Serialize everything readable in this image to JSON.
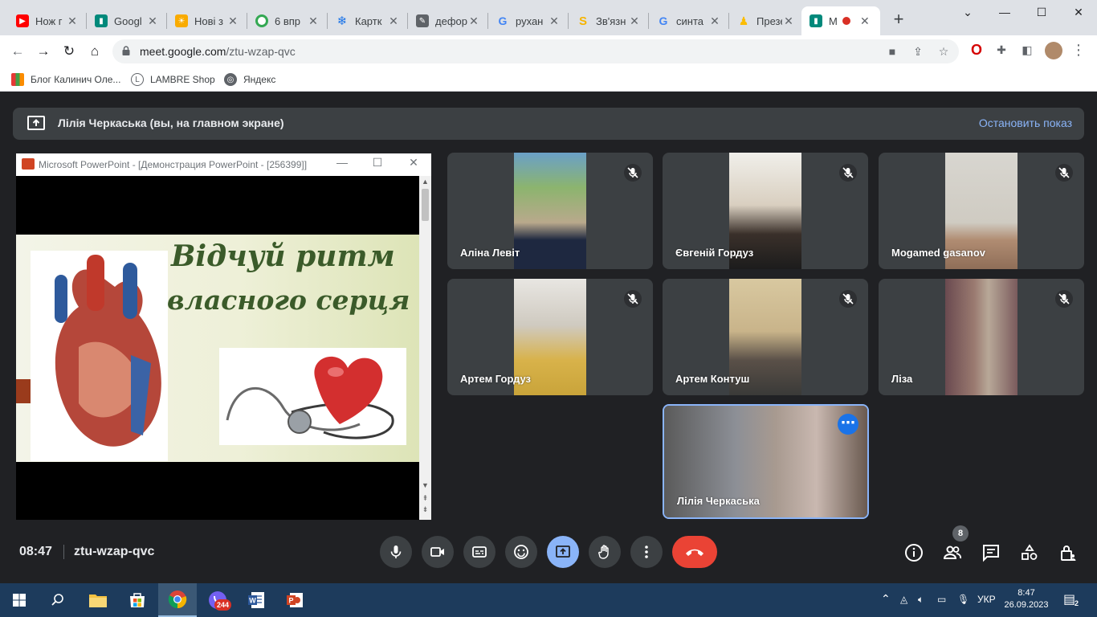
{
  "browser": {
    "tabs": [
      {
        "title": "Нож г",
        "icon": "youtube-icon",
        "color": "#ff0000"
      },
      {
        "title": "Googl",
        "icon": "meet-icon",
        "color": "#00897b"
      },
      {
        "title": "Нові з",
        "icon": "sun-icon",
        "color": "#f9ab00"
      },
      {
        "title": "6 впр",
        "icon": "circle-icon",
        "color": "#34a853"
      },
      {
        "title": "Картк",
        "icon": "snowflake-icon",
        "color": "#1a73e8"
      },
      {
        "title": "дефор",
        "icon": "pen-icon",
        "color": "#5f6368"
      },
      {
        "title": "рухан",
        "icon": "google-icon",
        "color": "#4285f4"
      },
      {
        "title": "Зв'язн",
        "icon": "s-icon",
        "color": "#f6b400"
      },
      {
        "title": "синта",
        "icon": "google-icon",
        "color": "#4285f4"
      },
      {
        "title": "Презе",
        "icon": "presentation-icon",
        "color": "#fbbc04"
      },
      {
        "title": "M",
        "icon": "meet-icon",
        "color": "#00897b"
      }
    ],
    "url_host": "meet.google.com",
    "url_path": "/ztu-wzap-qvc",
    "bookmarks": [
      {
        "label": "Блог Калинич Оле...",
        "icon": "bookmark-blog-icon"
      },
      {
        "label": "LAMBRE Shop",
        "icon": "lambre-icon"
      },
      {
        "label": "Яндекс",
        "icon": "globe-icon"
      }
    ]
  },
  "meet": {
    "banner_text": "Лілія Черкаська (вы, на главном экране)",
    "stop_label": "Остановить показ",
    "presentation_window_title": "Microsoft PowerPoint - [Демонстрация PowerPoint - [256399]]",
    "slide_title_line1": "Відчуй ритм",
    "slide_title_line2": "власного серця",
    "participants": [
      {
        "name": "Аліна Левіт",
        "muted": true,
        "color": "#b9a98c"
      },
      {
        "name": "Євгеній Гордуз",
        "muted": true,
        "color": "#d9cfc0"
      },
      {
        "name": "Mogamed gasanov",
        "muted": true,
        "color": "#d8d6d0"
      },
      {
        "name": "Артем Гордуз",
        "muted": true,
        "color": "#cfcac0"
      },
      {
        "name": "Артем Контуш",
        "muted": true,
        "color": "#c9b48a"
      },
      {
        "name": "Ліза",
        "muted": true,
        "color": "#7a5a5c"
      }
    ],
    "self": {
      "name": "Лілія Черкаська",
      "color": "#8c8f96"
    },
    "time": "08:47",
    "meeting_code": "ztu-wzap-qvc",
    "people_count": "8"
  },
  "taskbar": {
    "lang": "УКР",
    "time": "8:47",
    "date": "26.09.2023",
    "viber_badge": "244",
    "notif_count": "2"
  }
}
